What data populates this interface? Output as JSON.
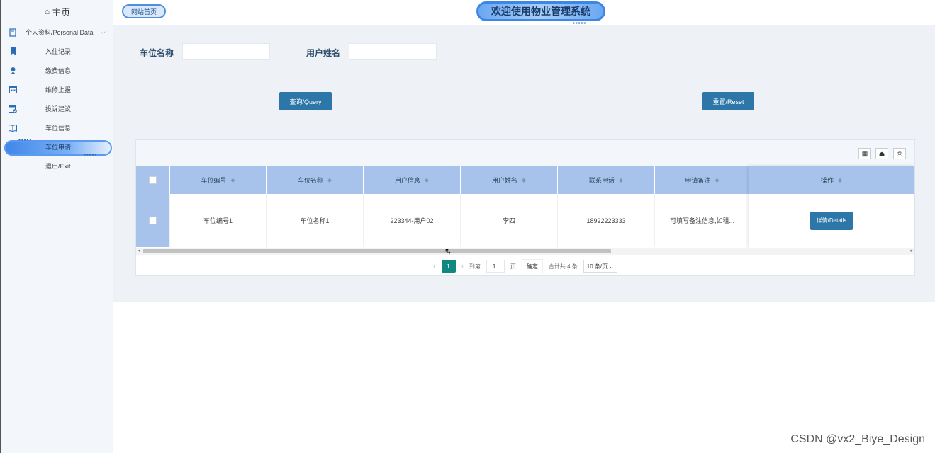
{
  "sidebar": {
    "home": "主页",
    "group_label": "个人资料/Personal Data",
    "items": [
      {
        "label": "入住记录",
        "icon": "bookmark-icon"
      },
      {
        "label": "缴费信息",
        "icon": "person-icon"
      },
      {
        "label": "维修上报",
        "icon": "calendar-icon"
      },
      {
        "label": "投诉建议",
        "icon": "calendar-check-icon"
      },
      {
        "label": "车位信息",
        "icon": "book-icon"
      },
      {
        "label": "车位申请",
        "icon": "none",
        "active": true
      }
    ],
    "exit": "退出/Exit"
  },
  "header": {
    "home_link": "网站首页",
    "title": "欢迎使用物业管理系统"
  },
  "search": {
    "field1_label": "车位名称",
    "field1_value": "",
    "field2_label": "用户姓名",
    "field2_value": "",
    "query_button": "查询/Query",
    "reset_button": "重置/Reset"
  },
  "table": {
    "columns": [
      "车位编号",
      "车位名称",
      "用户信息",
      "用户姓名",
      "联系电话",
      "申请备注"
    ],
    "ops_column": "操作",
    "rows": [
      {
        "cells": [
          "车位编号1",
          "车位名称1",
          "223344-用户02",
          "李四",
          "18922223333",
          "可填写备注信息,如租..."
        ],
        "action": "详情/Details"
      }
    ]
  },
  "pager": {
    "current_page": "1",
    "goto_label": "到第",
    "goto_value": "1",
    "page_suffix": "页",
    "confirm": "确定",
    "total": "合计共 4 条",
    "page_size": "10 条/页"
  },
  "watermark": "CSDN @vx2_Biye_Design",
  "colors": {
    "primary_button": "#2c77a8",
    "table_header": "#a7c3ec",
    "pager_active": "#11877f"
  }
}
